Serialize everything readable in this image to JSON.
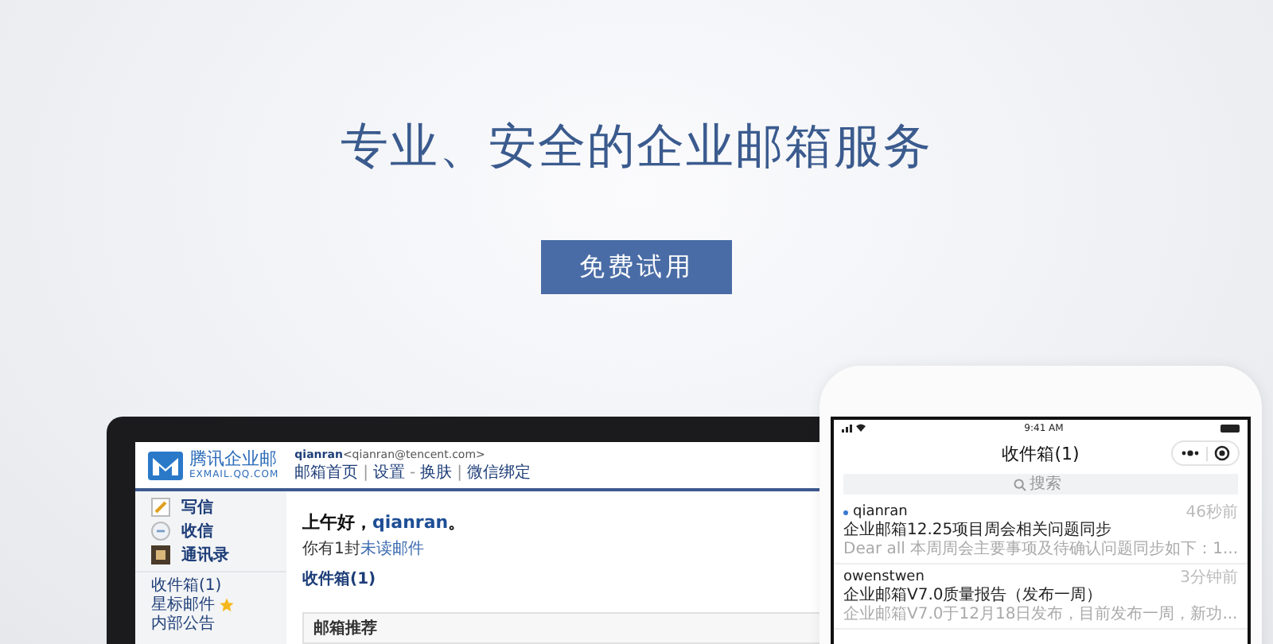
{
  "hero": {
    "headline": "专业、安全的企业邮箱服务",
    "cta": "免费试用"
  },
  "laptop": {
    "logo": {
      "name": "腾讯企业邮",
      "domain": "EXMAIL.QQ.COM"
    },
    "user": {
      "name": "qianran",
      "email": "<qianran@tencent.com>"
    },
    "nav": [
      "邮箱首页",
      "设置",
      "换肤",
      "微信绑定"
    ],
    "nav_separators": [
      "|",
      "-",
      "|"
    ],
    "actions": [
      {
        "label": "写信",
        "kind": "compose"
      },
      {
        "label": "收信",
        "kind": "receive"
      },
      {
        "label": "通讯录",
        "kind": "contacts"
      }
    ],
    "folders": [
      {
        "label": "收件箱(1)",
        "star": false
      },
      {
        "label": "星标邮件",
        "star": true
      },
      {
        "label": "内部公告",
        "star": false
      }
    ],
    "greeting": {
      "before": "上午好，",
      "name": "qianran",
      "after": "。"
    },
    "unread": {
      "before": "你有1封",
      "link": "未读邮件"
    },
    "inbox_link": "收件箱(1)",
    "panel_title": "邮箱推荐"
  },
  "phone": {
    "time": "9:41 AM",
    "title": "收件箱(1)",
    "search": {
      "placeholder": "搜索"
    },
    "mails": [
      {
        "sender": "qianran",
        "time": "46秒前",
        "subject": "企业邮箱12.25项目周会相关问题同步",
        "preview": "Dear all 本周周会主要事项及待确认问题同步如下：1...",
        "unread": true
      },
      {
        "sender": "owenstwen",
        "time": "3分钟前",
        "subject": "企业邮箱V7.0质量报告（发布一周）",
        "preview": "企业邮箱V7.0于12月18日发布，目前发布一周，新功...",
        "unread": false
      }
    ]
  }
}
